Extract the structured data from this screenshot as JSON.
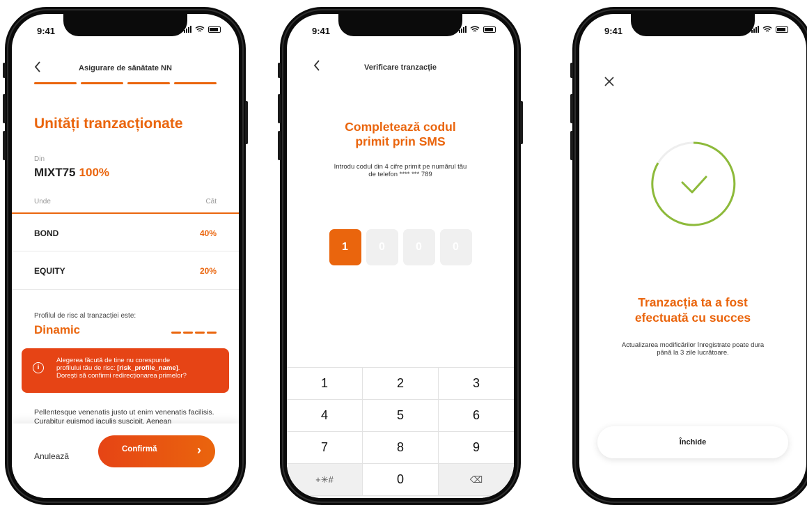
{
  "status": {
    "time": "9:41"
  },
  "screen1": {
    "header_title": "Asigurare de sănătate NN",
    "title": "Unități tranzacționate",
    "from_label": "Din",
    "from_fund": "MIXT75",
    "from_pct": "100%",
    "col_where": "Unde",
    "col_how_much": "Cât",
    "rows": [
      {
        "name": "BOND",
        "pct": "40%"
      },
      {
        "name": "EQUITY",
        "pct": "20%"
      }
    ],
    "risk_label": "Profilul de risc al tranzacției este:",
    "risk_value": "Dinamic",
    "alert_line1": "Alegerea făcută de tine nu corespunde",
    "alert_line2_prefix": "profilului tău de risc: ",
    "alert_line2_bold": "[risk_profile_name]",
    "alert_line2_suffix": ".",
    "alert_line3": "Dorești să confirmi redirecționarea primelor?",
    "body_text": "Pellentesque venenatis justo ut enim venenatis facilisis. Curabitur euismod iaculis suscipit. Aenean",
    "cancel_label": "Anulează",
    "confirm_label": "Confirmă"
  },
  "screen2": {
    "header_title": "Verificare tranzacție",
    "title_line1": "Completează codul",
    "title_line2": "primit prin SMS",
    "subtitle_line1": "Introdu codul din 4 cifre primit pe numărul tău",
    "subtitle_line2": "de telefon **** *** 789",
    "otp_digits": [
      "1",
      "0",
      "0",
      "0"
    ],
    "keypad": [
      [
        "1",
        "2",
        "3"
      ],
      [
        "4",
        "5",
        "6"
      ],
      [
        "7",
        "8",
        "9"
      ],
      [
        "+✳#",
        "0",
        "⌫"
      ]
    ]
  },
  "screen3": {
    "title_line1": "Tranzacția ta a fost",
    "title_line2": "efectuată cu succes",
    "subtitle_line1": "Actualizarea modificărilor înregistrate poate dura",
    "subtitle_line2": "până la 3 zile lucrătoare.",
    "close_label": "Închide"
  },
  "colors": {
    "accent": "#ea650d",
    "alert": "#e64415",
    "success": "#8dba3a"
  }
}
